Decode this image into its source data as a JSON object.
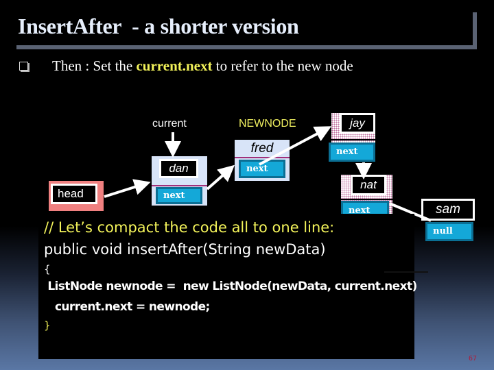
{
  "slide": {
    "title": "InsertAfter  - a shorter version",
    "bullet": {
      "icon": "square-bullet-icon",
      "prefix": "Then : Set the ",
      "highlight": "current.next",
      "suffix": " to refer to the new node"
    },
    "page_number": "67"
  },
  "diagram": {
    "labels": {
      "current": "current",
      "newnode": "NEWNODE"
    },
    "nodes": {
      "head": {
        "data": "head"
      },
      "dan": {
        "data": "dan",
        "next": "next"
      },
      "fred": {
        "data": "fred",
        "next": "next"
      },
      "jay": {
        "data": "jay",
        "next": "next"
      },
      "nat": {
        "data": "nat",
        "next": "next"
      },
      "sam": {
        "data": "sam",
        "next": "null"
      }
    },
    "colors": {
      "head_fill": "#f08080",
      "node_fill": "#d8e4f8",
      "next_fill": "#14a8d8",
      "highlight": "#f3f35a"
    }
  },
  "code": {
    "comment": "// Let’s compact the code all to one line:",
    "signature": "public void insertAfter(String newData)",
    "open_brace": "{",
    "line1": " ListNode newnode =  new ListNode(newData, current.next)",
    "line2": "   current.next = newnode;",
    "close_brace": "}"
  }
}
